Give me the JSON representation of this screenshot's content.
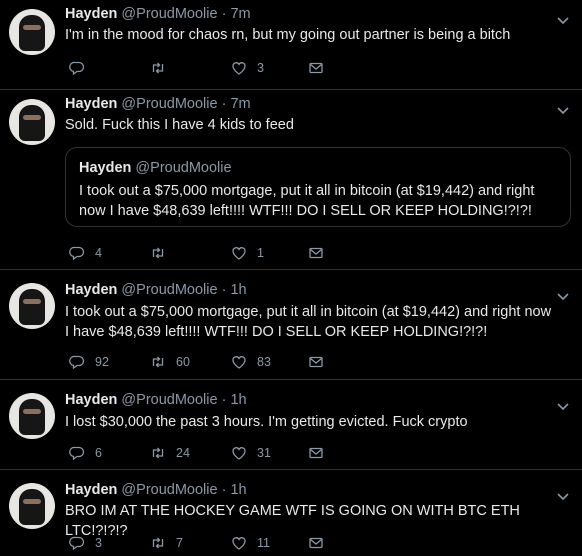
{
  "tweets": [
    {
      "name": "Hayden",
      "handle": "@ProudMoolie",
      "time": "· 7m",
      "text": "I'm in the mood for chaos rn, but my going out partner is being a bitch",
      "replies": "",
      "retweets": "",
      "likes": "3"
    },
    {
      "name": "Hayden",
      "handle": "@ProudMoolie",
      "time": "· 7m",
      "text": "Sold. Fuck this I have 4 kids to feed",
      "quote": {
        "name": "Hayden",
        "handle": "@ProudMoolie",
        "text": "I took out a $75,000 mortgage, put it all in bitcoin (at $19,442) and right now I have $48,639 left!!!! WTF!!! DO I SELL OR KEEP HOLDING!?!?!"
      },
      "replies": "4",
      "retweets": "",
      "likes": "1"
    },
    {
      "name": "Hayden",
      "handle": "@ProudMoolie",
      "time": "· 1h",
      "text": "I took out a $75,000 mortgage, put it all in bitcoin (at $19,442) and right now I have $48,639 left!!!! WTF!!! DO I SELL OR KEEP HOLDING!?!?!",
      "replies": "92",
      "retweets": "60",
      "likes": "83"
    },
    {
      "name": "Hayden",
      "handle": "@ProudMoolie",
      "time": "· 1h",
      "text": "I lost $30,000 the past 3 hours. I'm getting evicted. Fuck crypto",
      "replies": "6",
      "retweets": "24",
      "likes": "31"
    },
    {
      "name": "Hayden",
      "handle": "@ProudMoolie",
      "time": "· 1h",
      "text": "BRO IM AT THE HOCKEY GAME WTF IS GOING ON WITH BTC ETH LTC!?!?!?",
      "replies": "3",
      "retweets": "7",
      "likes": "11"
    }
  ],
  "icons": {
    "reply": "reply-icon",
    "retweet": "retweet-icon",
    "like": "heart-icon",
    "dm": "envelope-icon",
    "menu": "chevron-down-icon"
  },
  "colors": {
    "background": "#000000",
    "text": "#e7e9ea",
    "muted": "#8b98a5",
    "divider": "#2f3336"
  }
}
